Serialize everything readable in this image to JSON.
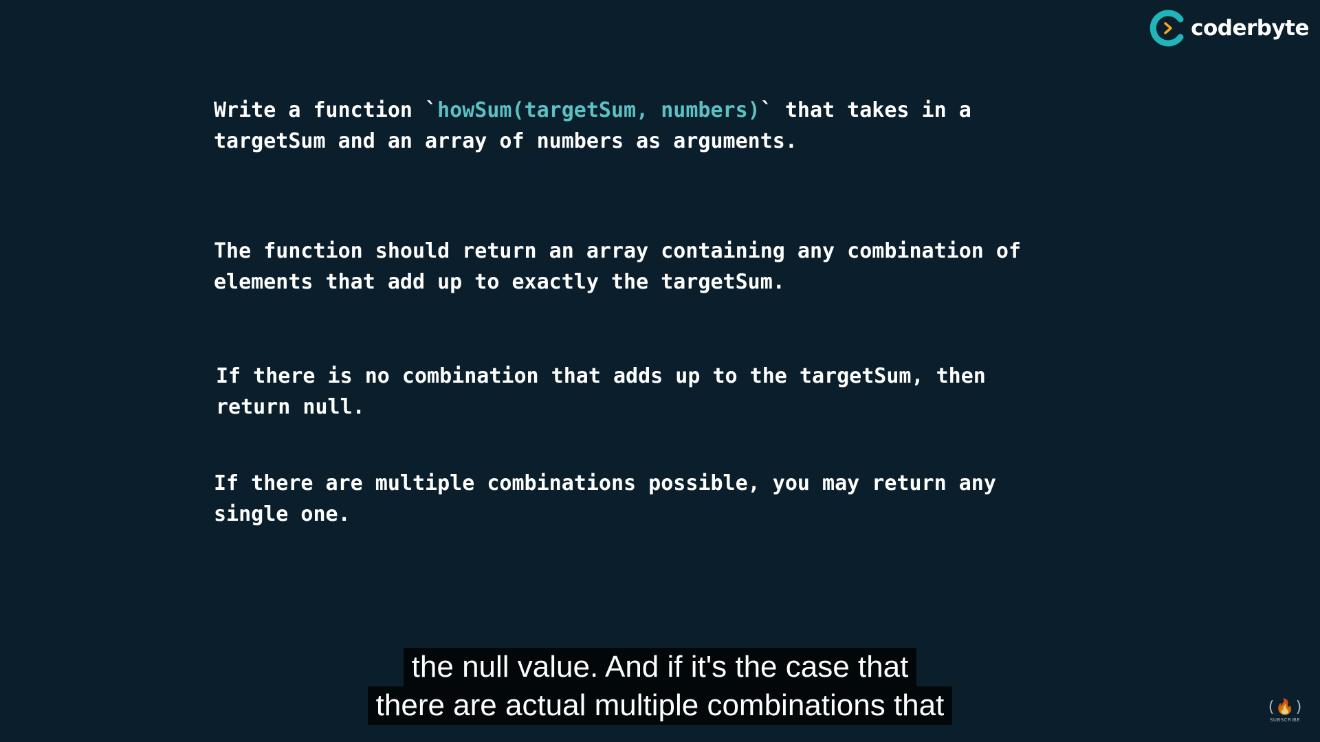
{
  "brand": {
    "name": "coderbyte",
    "accent_color": "#1fb5b9",
    "arrow_color": "#f5a623"
  },
  "problem": {
    "p1": {
      "pre": "Write a function `",
      "code": "howSum(targetSum, numbers)",
      "post": "` that takes in a\ntargetSum and an array of numbers as arguments."
    },
    "p2": "The function should return an array containing any combination of\nelements that add up to exactly the targetSum.",
    "p3": "If there is no combination that adds up to the targetSum, then\nreturn null.",
    "p4": "If there are multiple combinations possible, you may return any\nsingle one."
  },
  "subtitles": {
    "line1": "the null value. And if it's the case that",
    "line2": "there are actual multiple combinations that"
  },
  "watermark": {
    "icon": "freecodecamp-flame-icon",
    "label": "SUBSCRIBE"
  },
  "colors": {
    "background": "#0a1f2b",
    "text": "#ffffff",
    "code": "#5cc1c4"
  }
}
